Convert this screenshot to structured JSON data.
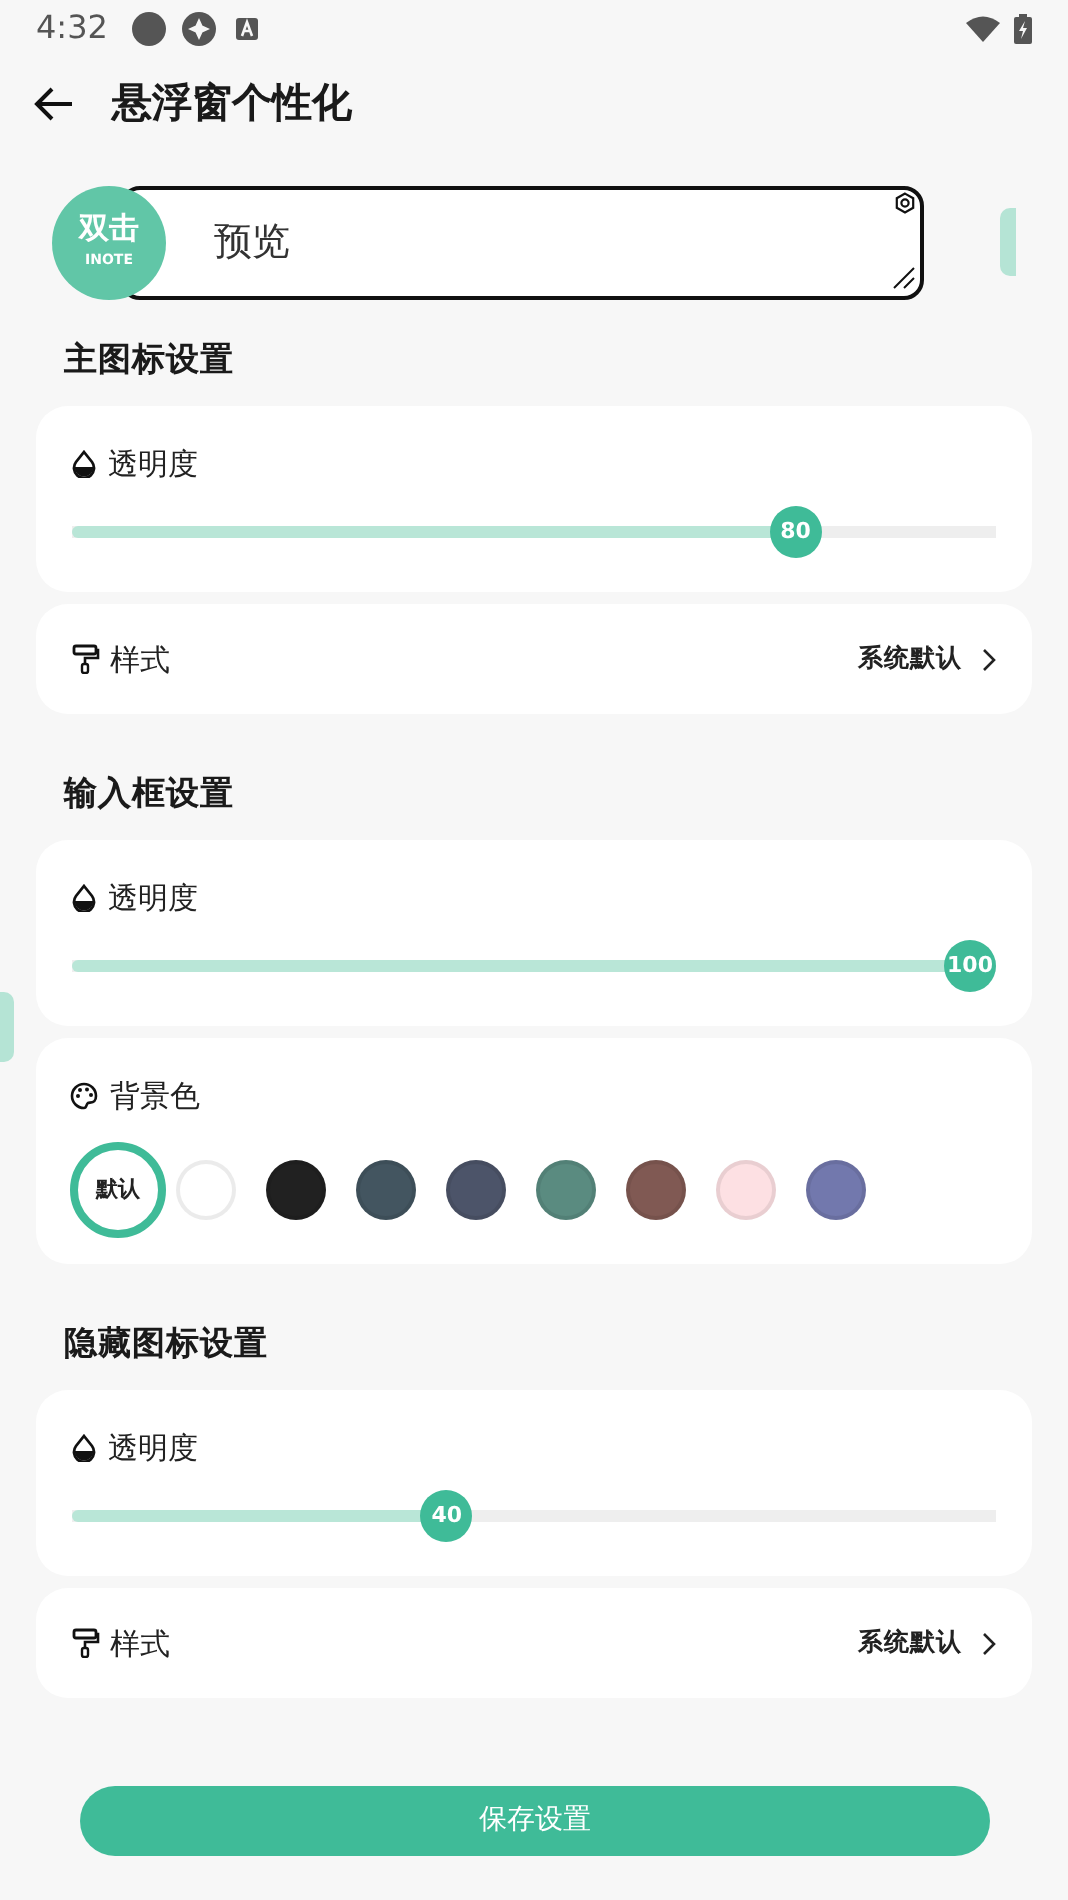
{
  "status_bar": {
    "time": "4:32"
  },
  "app_bar": {
    "title": "悬浮窗个性化"
  },
  "preview": {
    "bubble_text": "双击",
    "bubble_subtext": "INOTE",
    "text": "预览"
  },
  "sections": [
    {
      "title": "主图标设置",
      "rows": [
        {
          "kind": "slider",
          "label": "透明度",
          "level": 0.8,
          "reading": "80"
        },
        {
          "kind": "link",
          "label": "样式",
          "value": "系统默认"
        }
      ]
    },
    {
      "title": "输入框设置",
      "rows": [
        {
          "kind": "slider",
          "label": "透明度",
          "level": 1,
          "reading": "100"
        },
        {
          "kind": "colors",
          "label": "背景色",
          "swatches": [
            {
              "label": "默认",
              "selected": true
            },
            {
              "color": "#ffffff",
              "selected": false
            },
            {
              "color": "#212121",
              "selected": false
            },
            {
              "color": "#435560",
              "selected": false
            },
            {
              "color": "#4c5469",
              "selected": false
            },
            {
              "color": "#5a8b80",
              "selected": false
            },
            {
              "color": "#805953",
              "selected": false
            },
            {
              "color": "#fde0e3",
              "selected": false
            },
            {
              "color": "#7278ad",
              "selected": false
            }
          ]
        }
      ]
    },
    {
      "title": "隐藏图标设置",
      "rows": [
        {
          "kind": "slider",
          "label": "透明度",
          "level": 0.4,
          "reading": "40"
        },
        {
          "kind": "link",
          "label": "样式",
          "value": "系统默认"
        }
      ]
    }
  ],
  "save_button": "保存设置"
}
